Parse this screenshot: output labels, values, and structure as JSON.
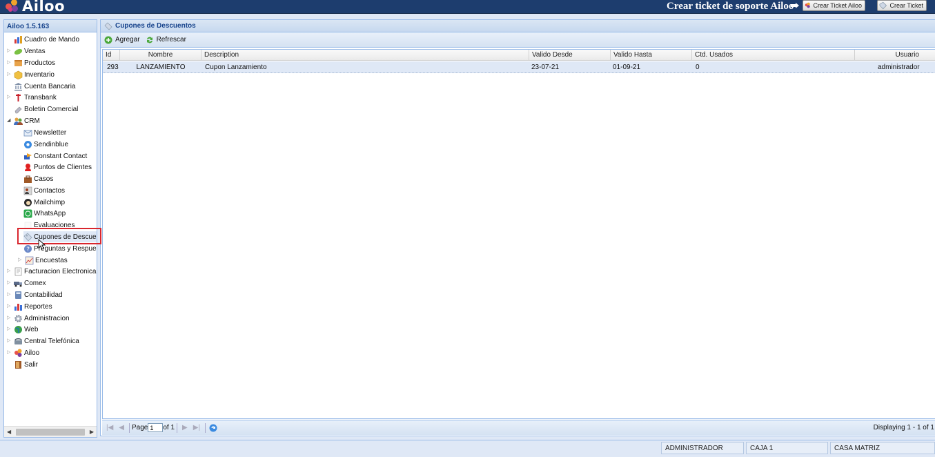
{
  "app": {
    "logo_text": "Ailoo",
    "support_title": "Crear ticket de soporte Ailoo",
    "btn_ticket_ailoo": "Crear Ticket Ailoo",
    "btn_ticket": "Crear Ticket"
  },
  "sidebar": {
    "version": "Ailoo 1.5.163",
    "items": [
      {
        "label": "Cuadro de Mando",
        "icon": "chart-icon"
      },
      {
        "label": "Ventas",
        "icon": "money-icon"
      },
      {
        "label": "Productos",
        "icon": "folder-icon"
      },
      {
        "label": "Inventario",
        "icon": "box-icon"
      },
      {
        "label": "Cuenta Bancaria",
        "icon": "bank-icon"
      },
      {
        "label": "Transbank",
        "icon": "transbank-icon"
      },
      {
        "label": "Boletin Comercial",
        "icon": "eraser-icon"
      },
      {
        "label": "CRM",
        "icon": "people-icon"
      },
      {
        "label": "Newsletter",
        "icon": "mail-icon"
      },
      {
        "label": "Sendinblue",
        "icon": "sendinblue-icon"
      },
      {
        "label": "Constant Contact",
        "icon": "contact-icon"
      },
      {
        "label": "Puntos de Clientes",
        "icon": "points-icon"
      },
      {
        "label": "Casos",
        "icon": "briefcase-icon"
      },
      {
        "label": "Contactos",
        "icon": "contacts-icon"
      },
      {
        "label": "Mailchimp",
        "icon": "mailchimp-icon"
      },
      {
        "label": "WhatsApp",
        "icon": "whatsapp-icon"
      },
      {
        "label": "Evaluaciones",
        "icon": "evaluation-icon"
      },
      {
        "label": "Cupones de Descuento",
        "icon": "coupon-icon"
      },
      {
        "label": "Preguntas y Respuestas",
        "icon": "question-icon"
      },
      {
        "label": "Encuestas",
        "icon": "survey-icon"
      },
      {
        "label": "Facturacion Electronica",
        "icon": "invoice-icon"
      },
      {
        "label": "Comex",
        "icon": "truck-icon"
      },
      {
        "label": "Contabilidad",
        "icon": "calculator-icon"
      },
      {
        "label": "Reportes",
        "icon": "report-icon"
      },
      {
        "label": "Administracion",
        "icon": "gear-icon"
      },
      {
        "label": "Web",
        "icon": "globe-icon"
      },
      {
        "label": "Central Telefónica",
        "icon": "phone-icon"
      },
      {
        "label": "Ailoo",
        "icon": "ailoo-icon"
      },
      {
        "label": "Salir",
        "icon": "exit-icon"
      }
    ]
  },
  "main": {
    "title": "Cupones de Descuentos",
    "toolbar": {
      "add": "Agregar",
      "refresh": "Refrescar"
    },
    "columns": [
      "Id",
      "Nombre",
      "Description",
      "Valido Desde",
      "Valido Hasta",
      "Ctd. Usados",
      "Usuario"
    ],
    "rows": [
      {
        "id": "293",
        "nombre": "LANZAMIENTO",
        "description": "Cupon Lanzamiento",
        "desde": "23-07-21",
        "hasta": "01-09-21",
        "usados": "0",
        "usuario": "administrador"
      }
    ],
    "pager": {
      "page_label": "Page",
      "page_value": "1",
      "of_label": "of 1",
      "displaying": "Displaying 1 - 1 of 1"
    }
  },
  "status": {
    "user": "ADMINISTRADOR",
    "caja": "CAJA 1",
    "sucursal": "CASA MATRIZ"
  }
}
